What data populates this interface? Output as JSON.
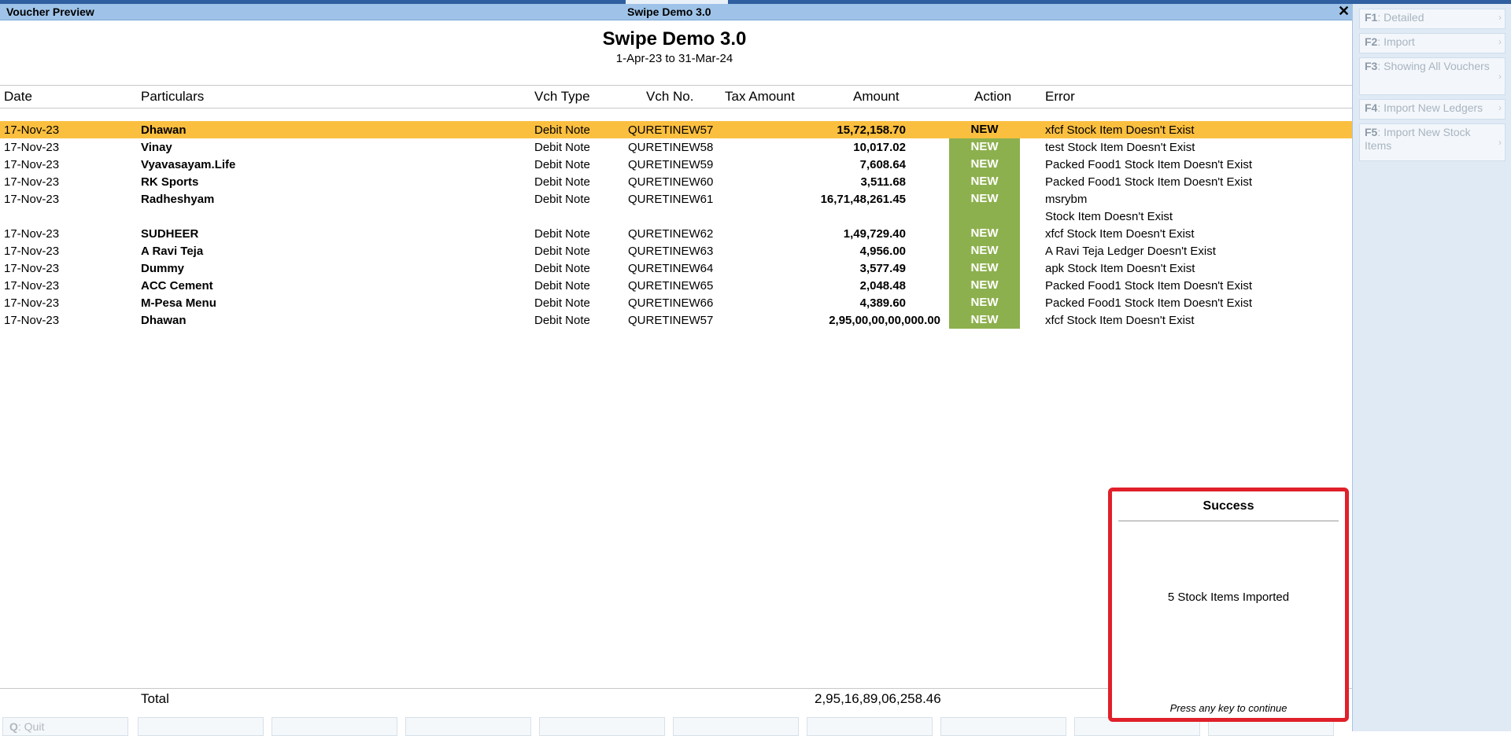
{
  "window": {
    "left_title": "Voucher Preview",
    "center_title": "Swipe Demo 3.0",
    "close_glyph": "✕"
  },
  "report": {
    "company": "Swipe Demo 3.0",
    "period": "1-Apr-23 to 31-Mar-24"
  },
  "columns": {
    "date": "Date",
    "particulars": "Particulars",
    "vch_type": "Vch Type",
    "vch_no": "Vch No.",
    "tax_amount": "Tax Amount",
    "amount": "Amount",
    "action": "Action",
    "error": "Error"
  },
  "rows": [
    {
      "date": "17-Nov-23",
      "party": "Dhawan",
      "type": "Debit Note",
      "no": "QURETINEW57",
      "amount": "15,72,158.70",
      "action": "NEW",
      "error": "xfcf Stock Item Doesn't Exist"
    },
    {
      "date": "17-Nov-23",
      "party": "Vinay",
      "type": "Debit Note",
      "no": "QURETINEW58",
      "amount": "10,017.02",
      "action": "NEW",
      "error": "test Stock Item Doesn't Exist"
    },
    {
      "date": "17-Nov-23",
      "party": "Vyavasayam.Life",
      "type": "Debit Note",
      "no": "QURETINEW59",
      "amount": "7,608.64",
      "action": "NEW",
      "error": "Packed Food1 Stock Item Doesn't Exist"
    },
    {
      "date": "17-Nov-23",
      "party": "RK Sports",
      "type": "Debit Note",
      "no": "QURETINEW60",
      "amount": "3,511.68",
      "action": "NEW",
      "error": "Packed Food1 Stock Item Doesn't Exist"
    },
    {
      "date": "17-Nov-23",
      "party": "Radheshyam",
      "type": "Debit Note",
      "no": "QURETINEW61",
      "amount": "16,71,48,261.45",
      "action": "NEW",
      "error": "msrybm",
      "error2": " Stock Item Doesn't Exist"
    },
    {
      "date": "17-Nov-23",
      "party": "SUDHEER",
      "type": "Debit Note",
      "no": "QURETINEW62",
      "amount": "1,49,729.40",
      "action": "NEW",
      "error": "xfcf Stock Item Doesn't Exist"
    },
    {
      "date": "17-Nov-23",
      "party": "A Ravi Teja",
      "type": "Debit Note",
      "no": "QURETINEW63",
      "amount": "4,956.00",
      "action": "NEW",
      "error": "A Ravi Teja Ledger Doesn't Exist"
    },
    {
      "date": "17-Nov-23",
      "party": "Dummy",
      "type": "Debit Note",
      "no": "QURETINEW64",
      "amount": "3,577.49",
      "action": "NEW",
      "error": "apk Stock Item Doesn't Exist"
    },
    {
      "date": "17-Nov-23",
      "party": "ACC Cement",
      "type": "Debit Note",
      "no": "QURETINEW65",
      "amount": "2,048.48",
      "action": "NEW",
      "error": "Packed Food1 Stock Item Doesn't Exist"
    },
    {
      "date": "17-Nov-23",
      "party": "M-Pesa Menu",
      "type": "Debit Note",
      "no": "QURETINEW66",
      "amount": "4,389.60",
      "action": "NEW",
      "error": "Packed Food1 Stock Item Doesn't Exist"
    },
    {
      "date": "17-Nov-23",
      "party": "Dhawan",
      "type": "Debit Note",
      "no": "QURETINEW57",
      "amount": "2,95,00,00,00,000.00",
      "action": "NEW",
      "error": "xfcf Stock Item Doesn't Exist"
    }
  ],
  "total": {
    "label": "Total",
    "amount": "2,95,16,89,06,258.46"
  },
  "side_buttons": [
    {
      "key": "F1",
      "text": "Detailed"
    },
    {
      "key": "F2",
      "text": "Import"
    },
    {
      "key": "F3",
      "text": "Showing All Vouchers"
    },
    {
      "key": "F4",
      "text": "Import New Ledgers"
    },
    {
      "key": "F5",
      "text": "Import New Stock Items"
    }
  ],
  "bottom": {
    "quit_key": "Q",
    "quit_text": "Quit"
  },
  "popup": {
    "title": "Success",
    "message": "5 Stock Items Imported",
    "footer": "Press any key to continue"
  },
  "colors": {
    "selected_row": "#fbbf3f",
    "action_green": "#8db04e",
    "popup_border": "#e0202a",
    "titlebar": "#9fc3e8"
  }
}
